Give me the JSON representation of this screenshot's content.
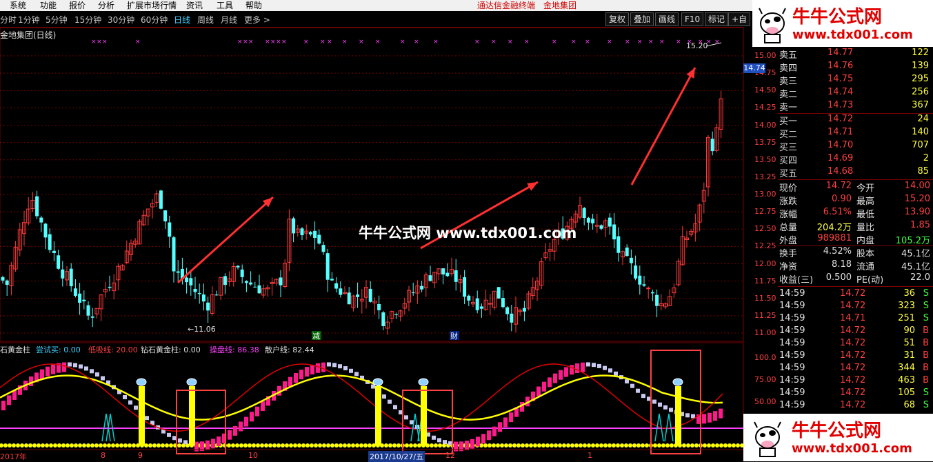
{
  "menu": {
    "items": [
      "系统",
      "功能",
      "报价",
      "分析",
      "扩展市场行情",
      "资讯",
      "工具",
      "帮助"
    ],
    "vendor1": "通达信金融终端",
    "vendor2": "金地集团"
  },
  "toolbar": {
    "periods": [
      "分时",
      "1分钟",
      "5分钟",
      "15分钟",
      "30分钟",
      "60分钟",
      "日线",
      "周线",
      "月线",
      "更多 >"
    ],
    "active_period": "日线",
    "buttons": [
      "复权",
      "叠加",
      "画线",
      "F10",
      "标记",
      "+自"
    ]
  },
  "chart_title": "金地集团(日线)",
  "main_chart": {
    "type": "candlestick",
    "price_axis": [
      "15.00",
      "14.75",
      "14.50",
      "14.25",
      "14.00",
      "13.75",
      "13.50",
      "13.25",
      "13.00",
      "12.75",
      "12.50",
      "12.25",
      "12.00",
      "11.75",
      "11.50",
      "11.25",
      "11.00"
    ],
    "ylim": [
      10.95,
      15.3
    ],
    "current_price_badge": "14.74",
    "high_label": "15.20",
    "low_label": "11.06",
    "event_markers": [
      "减",
      "财"
    ],
    "colors": {
      "up": "#ff3b3b",
      "down": "#54ffff",
      "grid": "#7a0000",
      "marker": "#ff40ff"
    }
  },
  "indicator": {
    "labels": [
      {
        "text": "石黄金柱",
        "color": "#e0e0e0"
      },
      {
        "text": "尝试买: 0.00",
        "color": "#3fd0ff"
      },
      {
        "text": "低吸线: 20.00",
        "color": "#ff4040"
      },
      {
        "text": "钻石黄金柱: 0.00",
        "color": "#e0e0e0"
      },
      {
        "text": "操盘线: 86.38",
        "color": "#ff40ff"
      },
      {
        "text": "散户线: 82.44",
        "color": "#e0e0e0"
      }
    ],
    "axis": [
      "100.0",
      "75.00",
      "50.00"
    ],
    "time_axis": [
      "2017年",
      "8",
      "9",
      "10",
      "2017/10/27/五",
      "12",
      "1"
    ]
  },
  "quotes": {
    "asks": [
      {
        "label": "卖五",
        "price": "14.77",
        "vol": "122"
      },
      {
        "label": "卖四",
        "price": "14.76",
        "vol": "139"
      },
      {
        "label": "卖三",
        "price": "14.75",
        "vol": "295"
      },
      {
        "label": "卖二",
        "price": "14.74",
        "vol": "256"
      },
      {
        "label": "卖一",
        "price": "14.73",
        "vol": "367"
      }
    ],
    "bids": [
      {
        "label": "买一",
        "price": "14.72",
        "vol": "24"
      },
      {
        "label": "买二",
        "price": "14.71",
        "vol": "140"
      },
      {
        "label": "买三",
        "price": "14.70",
        "vol": "707"
      },
      {
        "label": "买四",
        "price": "14.69",
        "vol": "2"
      },
      {
        "label": "买五",
        "price": "14.68",
        "vol": "85"
      }
    ],
    "stats": [
      {
        "l1": "现价",
        "v1": "14.72",
        "l2": "今开",
        "v2": "14.00",
        "c1": "#ff4040",
        "c2": "#ff4040"
      },
      {
        "l1": "涨跌",
        "v1": "0.90",
        "l2": "最高",
        "v2": "15.20",
        "c1": "#ff4040",
        "c2": "#ff4040"
      },
      {
        "l1": "涨幅",
        "v1": "6.51%",
        "l2": "最低",
        "v2": "13.90",
        "c1": "#ff4040",
        "c2": "#ff4040"
      },
      {
        "l1": "总量",
        "v1": "204.2万",
        "l2": "量比",
        "v2": "1.85",
        "c1": "#ffff40",
        "c2": "#ff4040"
      },
      {
        "l1": "外盘",
        "v1": "989881",
        "l2": "内盘",
        "v2": "105.2万",
        "c1": "#ff4040",
        "c2": "#40ff40"
      },
      {
        "l1": "换手",
        "v1": "4.52%",
        "l2": "股本",
        "v2": "45.1亿",
        "c1": "#e0e0e0",
        "c2": "#e0e0e0"
      },
      {
        "l1": "净资",
        "v1": "8.18",
        "l2": "流通",
        "v2": "45.1亿",
        "c1": "#e0e0e0",
        "c2": "#e0e0e0"
      },
      {
        "l1": "收益(三)",
        "v1": "0.500",
        "l2": "PE(动)",
        "v2": "22.0",
        "c1": "#e0e0e0",
        "c2": "#e0e0e0"
      }
    ],
    "ticks": [
      {
        "time": "14:59",
        "price": "14.72",
        "vol": "36",
        "side": "S"
      },
      {
        "time": "14:59",
        "price": "14.72",
        "vol": "323",
        "side": "S"
      },
      {
        "time": "14:59",
        "price": "14.71",
        "vol": "251",
        "side": "S"
      },
      {
        "time": "14:59",
        "price": "14.72",
        "vol": "90",
        "side": "B"
      },
      {
        "time": "14:59",
        "price": "14.72",
        "vol": "51",
        "side": "B"
      },
      {
        "time": "14:59",
        "price": "14.72",
        "vol": "31",
        "side": "B"
      },
      {
        "time": "14:59",
        "price": "14.72",
        "vol": "344",
        "side": "B"
      },
      {
        "time": "14:59",
        "price": "14.72",
        "vol": "463",
        "side": "B"
      },
      {
        "time": "14:59",
        "price": "14.72",
        "vol": "105",
        "side": "S"
      },
      {
        "time": "14:59",
        "price": "14.72",
        "vol": "68",
        "side": "S"
      }
    ]
  },
  "watermark": {
    "center": "牛牛公式网 www.tdx001.com",
    "logo_cn": "牛牛公式网",
    "logo_url": "www.tdx001.com"
  }
}
